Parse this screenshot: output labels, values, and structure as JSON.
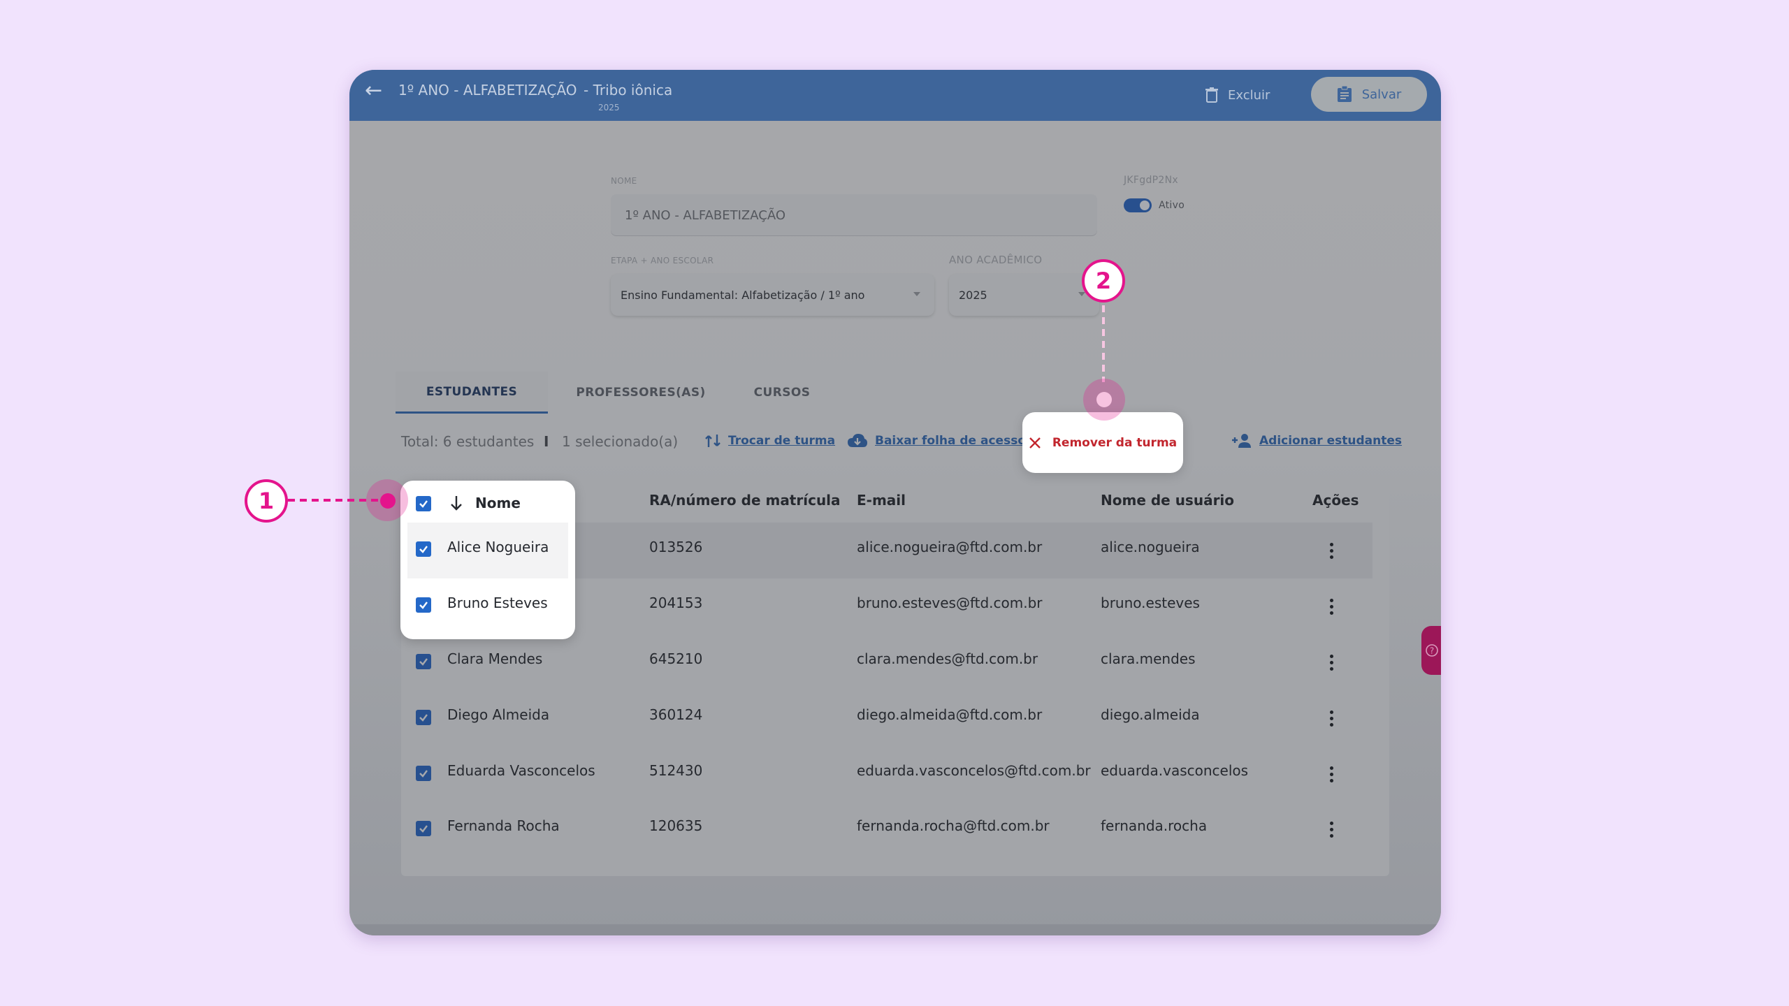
{
  "header": {
    "title": "1º ANO - ALFABETIZAÇÃO",
    "subtitle": "-  Tribo iônica",
    "year": "2025",
    "delete_label": "Excluir",
    "save_label": "Salvar"
  },
  "form": {
    "name_label": "NOME",
    "name_value": "1º ANO - ALFABETIZAÇÃO",
    "code": "JKFgdP2Nx",
    "active_label": "Ativo",
    "stage_label": "ETAPA + ANO ESCOLAR",
    "stage_value": "Ensino Fundamental: Alfabetização / 1º ano",
    "academic_year_label": "ANO ACADÊMICO",
    "academic_year_value": "2025"
  },
  "tabs": [
    {
      "label": "ESTUDANTES"
    },
    {
      "label": "PROFESSORES(AS)"
    },
    {
      "label": "CURSOS"
    }
  ],
  "toolbar": {
    "total": "Total: 6 estudantes",
    "separator": "I",
    "selected": "1 selecionado(a)",
    "switch_label": "Trocar de turma",
    "download_label": "Baixar folha de acesso",
    "remove_label": "Remover da turma",
    "add_label": "Adicionar estudantes"
  },
  "table": {
    "headers": {
      "name": "Nome",
      "ra": "RA/número de matrícula",
      "email": "E-mail",
      "username": "Nome de usuário",
      "actions": "Ações"
    },
    "rows": [
      {
        "name": "Alice Nogueira",
        "ra": "013526",
        "email": "alice.nogueira@ftd.com.br",
        "username": "alice.nogueira"
      },
      {
        "name": "Bruno Esteves",
        "ra": "204153",
        "email": "bruno.esteves@ftd.com.br",
        "username": "bruno.esteves"
      },
      {
        "name": "Clara Mendes",
        "ra": "645210",
        "email": "clara.mendes@ftd.com.br",
        "username": "clara.mendes"
      },
      {
        "name": "Diego Almeida",
        "ra": "360124",
        "email": "diego.almeida@ftd.com.br",
        "username": "diego.almeida"
      },
      {
        "name": "Eduarda Vasconcelos",
        "ra": "512430",
        "email": "eduarda.vasconcelos@ftd.com.br",
        "username": "eduarda.vasconcelos"
      },
      {
        "name": "Fernanda Rocha",
        "ra": "120635",
        "email": "fernanda.rocha@ftd.com.br",
        "username": "fernanda.rocha"
      }
    ]
  },
  "callouts": {
    "one": "1",
    "two": "2"
  },
  "colors": {
    "background": "#f1e3fd",
    "topbar": "#3e659a",
    "accent": "#e4148c",
    "danger": "#c2262e",
    "link": "#2e5385"
  },
  "icons": {
    "back": "arrow-left-icon",
    "delete": "trash-icon",
    "save": "clipboard-icon",
    "switch": "swap-icon",
    "download": "cloud-download-icon",
    "remove": "close-icon",
    "add": "person-add-icon",
    "sort": "arrow-down-icon",
    "help": "help-circle-icon"
  }
}
